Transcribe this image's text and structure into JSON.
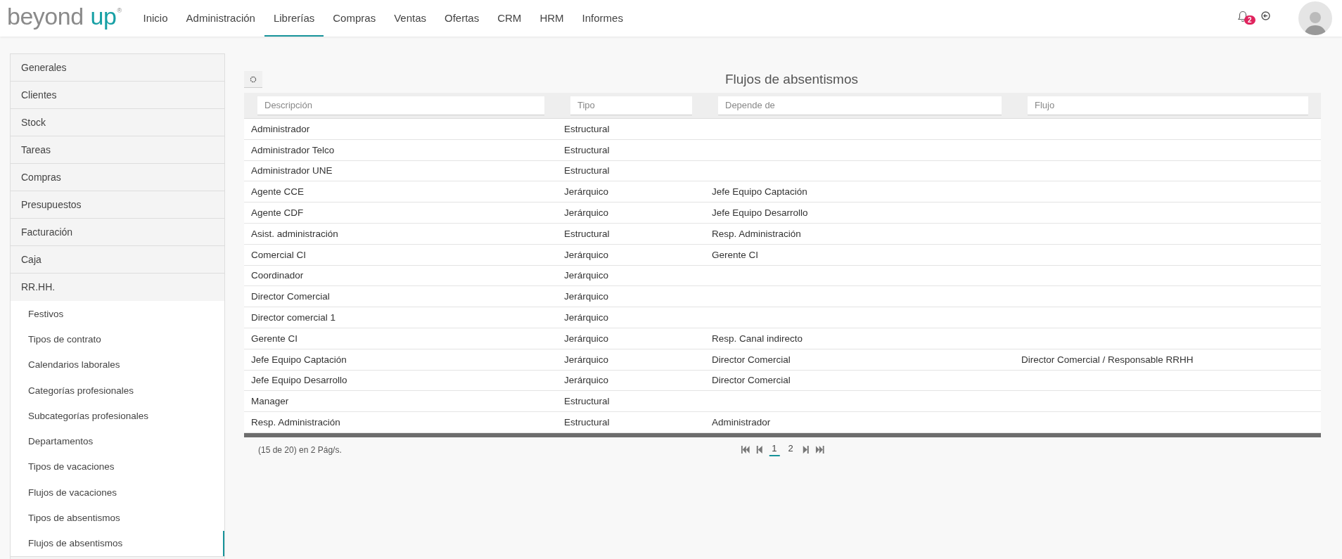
{
  "logo": {
    "word1": "beyond",
    "word2": "up",
    "mark": "®"
  },
  "nav": [
    {
      "label": "Inicio",
      "selected": false
    },
    {
      "label": "Administración",
      "selected": false
    },
    {
      "label": "Librerías",
      "selected": true
    },
    {
      "label": "Compras",
      "selected": false
    },
    {
      "label": "Ventas",
      "selected": false
    },
    {
      "label": "Ofertas",
      "selected": false
    },
    {
      "label": "CRM",
      "selected": false
    },
    {
      "label": "HRM",
      "selected": false
    },
    {
      "label": "Informes",
      "selected": false
    }
  ],
  "notifications": {
    "count": "2"
  },
  "sidebar": {
    "items": [
      {
        "label": "Generales",
        "expanded": false
      },
      {
        "label": "Clientes",
        "expanded": false
      },
      {
        "label": "Stock",
        "expanded": false
      },
      {
        "label": "Tareas",
        "expanded": false
      },
      {
        "label": "Compras",
        "expanded": false
      },
      {
        "label": "Presupuestos",
        "expanded": false
      },
      {
        "label": "Facturación",
        "expanded": false
      },
      {
        "label": "Caja",
        "expanded": false
      },
      {
        "label": "RR.HH.",
        "expanded": true,
        "children": [
          {
            "label": "Festivos",
            "selected": false
          },
          {
            "label": "Tipos de contrato",
            "selected": false
          },
          {
            "label": "Calendarios laborales",
            "selected": false
          },
          {
            "label": "Categorías profesionales",
            "selected": false
          },
          {
            "label": "Subcategorías profesionales",
            "selected": false
          },
          {
            "label": "Departamentos",
            "selected": false
          },
          {
            "label": "Tipos de vacaciones",
            "selected": false
          },
          {
            "label": "Flujos de vacaciones",
            "selected": false
          },
          {
            "label": "Tipos de absentismos",
            "selected": false
          },
          {
            "label": "Flujos de absentismos",
            "selected": true
          }
        ]
      }
    ]
  },
  "page": {
    "title": "Flujos de absentismos"
  },
  "table": {
    "filters": [
      {
        "placeholder": "Descripción"
      },
      {
        "placeholder": "Tipo"
      },
      {
        "placeholder": "Depende de"
      },
      {
        "placeholder": "Flujo"
      }
    ],
    "rows": [
      [
        "Administrador",
        "Estructural",
        "",
        ""
      ],
      [
        "Administrador Telco",
        "Estructural",
        "",
        ""
      ],
      [
        "Administrador UNE",
        "Estructural",
        "",
        ""
      ],
      [
        "Agente CCE",
        "Jerárquico",
        "Jefe Equipo Captación",
        ""
      ],
      [
        "Agente CDF",
        "Jerárquico",
        "Jefe Equipo Desarrollo",
        ""
      ],
      [
        "Asist. administración",
        "Estructural",
        "Resp. Administración",
        ""
      ],
      [
        "Comercial CI",
        "Jerárquico",
        "Gerente CI",
        ""
      ],
      [
        "Coordinador",
        "Jerárquico",
        "",
        ""
      ],
      [
        "Director Comercial",
        "Jerárquico",
        "",
        ""
      ],
      [
        "Director comercial 1",
        "Jerárquico",
        "",
        ""
      ],
      [
        "Gerente CI",
        "Jerárquico",
        "Resp. Canal indirecto",
        ""
      ],
      [
        "Jefe Equipo Captación",
        "Jerárquico",
        "Director Comercial",
        "Director Comercial / Responsable RRHH"
      ],
      [
        "Jefe Equipo Desarrollo",
        "Jerárquico",
        "Director Comercial",
        ""
      ],
      [
        "Manager",
        "Estructural",
        "",
        ""
      ],
      [
        "Resp. Administración",
        "Estructural",
        "Administrador",
        ""
      ]
    ]
  },
  "pagination": {
    "summary": "(15 de 20) en 2 Pág/s.",
    "pages": [
      {
        "label": "1",
        "selected": true
      },
      {
        "label": "2",
        "selected": false
      }
    ]
  }
}
